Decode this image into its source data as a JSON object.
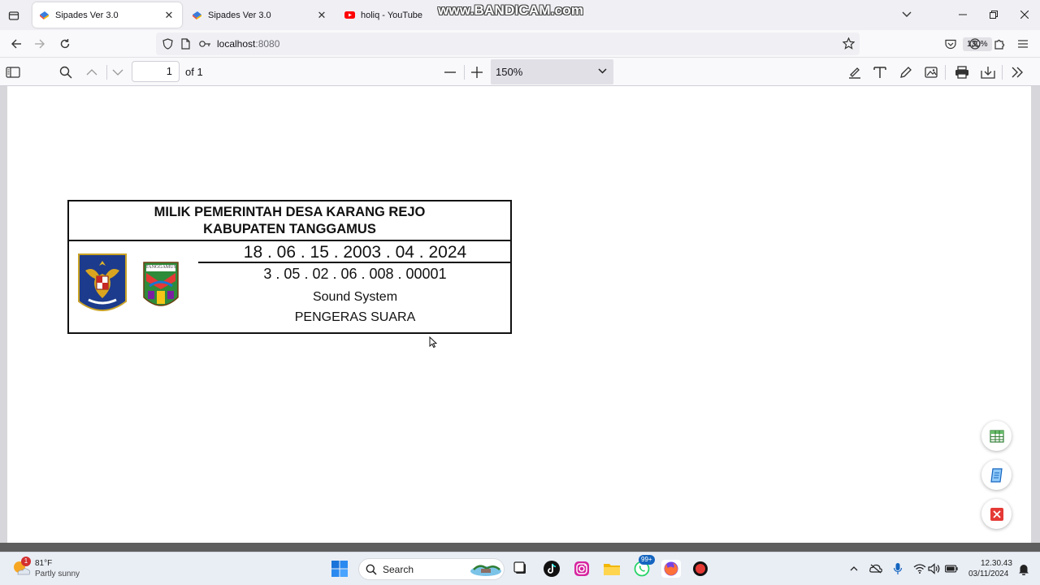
{
  "tabs": [
    {
      "title": "Sipades Ver 3.0",
      "active": true
    },
    {
      "title": "Sipades Ver 3.0",
      "active": false
    },
    {
      "title": "holiq - YouTube",
      "active": false
    }
  ],
  "watermark": "www.BANDICAM.com",
  "address": {
    "host": "localhost",
    "port": ":8080"
  },
  "browser_zoom": "130%",
  "pdf_toolbar": {
    "page_number": "1",
    "page_count": "of 1",
    "zoom": "150%"
  },
  "label": {
    "header_line1": "MILIK PEMERINTAH DESA KARANG REJO",
    "header_line2": "KABUPATEN TANGGAMUS",
    "code_location": "18 . 06 . 15 . 2003 . 04 . 2024",
    "code_item": "3 . 05 . 02 . 06 . 008 . 00001",
    "item_name": "Sound System",
    "item_name_local": "PENGERAS SUARA",
    "regency_logo_text": "TANGGAMUS"
  },
  "taskbar": {
    "weather_temp": "81°F",
    "weather_desc": "Partly sunny",
    "weather_badge": "1",
    "search_label": "Search",
    "whatsapp_badge": "99+",
    "time": "12.30.43",
    "date": "03/11/2024"
  },
  "colors": {
    "accent": "#0060df",
    "youtube": "#ff0000",
    "label_border": "#111111"
  }
}
